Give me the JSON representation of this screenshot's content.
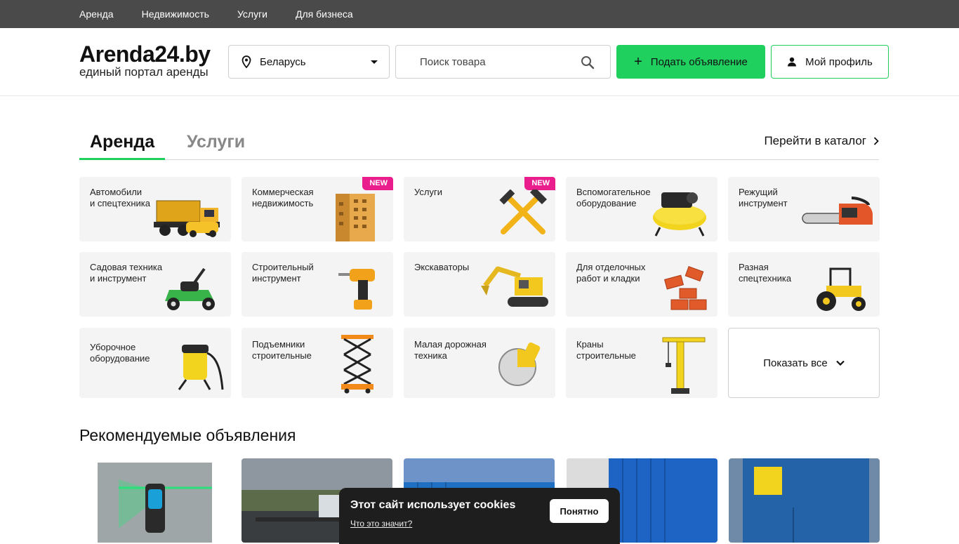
{
  "topnav": {
    "items": [
      "Аренда",
      "Недвижимость",
      "Услуги",
      "Для бизнеса"
    ]
  },
  "header": {
    "logo_title": "Arenda24.by",
    "logo_subtitle": "единый портал аренды",
    "region": "Беларусь",
    "search_placeholder": "Поиск товара",
    "post_button": "Подать объявление",
    "profile_button": "Мой профиль"
  },
  "tabs": {
    "active": "Аренда",
    "inactive": "Услуги",
    "catalog_link": "Перейти в каталог"
  },
  "categories": [
    {
      "label": "Автомобили\nи спецтехника",
      "icon": "dump-truck-icon"
    },
    {
      "label": "Коммерческая\nнедвижимость",
      "icon": "building-icon",
      "badge": "NEW"
    },
    {
      "label": "Услуги",
      "icon": "tools-icon",
      "badge": "NEW"
    },
    {
      "label": "Вспомогательное\nоборудование",
      "icon": "compressor-icon"
    },
    {
      "label": "Режущий\nинструмент",
      "icon": "chainsaw-icon"
    },
    {
      "label": "Садовая техника\nи инструмент",
      "icon": "lawnmower-icon"
    },
    {
      "label": "Строительный\nинструмент",
      "icon": "drill-icon"
    },
    {
      "label": "Экскаваторы",
      "icon": "excavator-icon"
    },
    {
      "label": "Для отделочных\nработ и кладки",
      "icon": "bricks-icon"
    },
    {
      "label": "Разная\nспецтехника",
      "icon": "tractor-icon"
    },
    {
      "label": "Уборочное\nоборудование",
      "icon": "vacuum-icon"
    },
    {
      "label": "Подъемники\nстроительные",
      "icon": "scissor-lift-icon"
    },
    {
      "label": "Малая дорожная\nтехника",
      "icon": "road-saw-icon"
    },
    {
      "label": "Краны\nстроительные",
      "icon": "crane-icon"
    }
  ],
  "show_all": "Показать все",
  "recommended": {
    "title": "Рекомендуемые объявления"
  },
  "cookie": {
    "title": "Этот сайт использует cookies",
    "link": "Что это значит?",
    "button": "Понятно"
  },
  "colors": {
    "accent": "#1fd05f",
    "topbar": "#4a4a4a",
    "badge": "#e91e8c"
  }
}
